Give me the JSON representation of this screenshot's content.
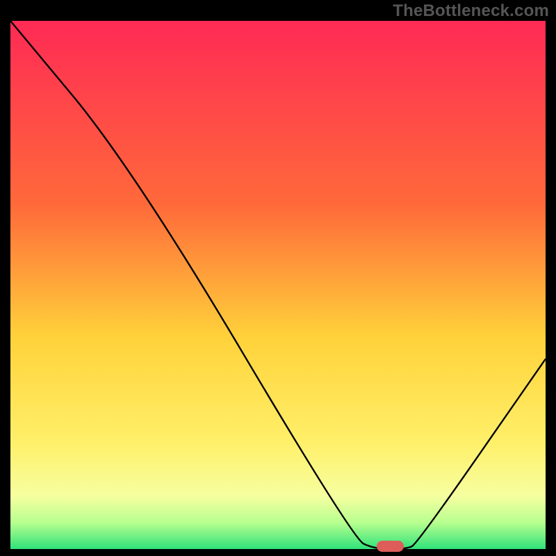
{
  "watermark": "TheBottleneck.com",
  "marker": {
    "label": "optimal-range",
    "x_center_pct": 71,
    "width_pct": 5
  },
  "chart_data": {
    "type": "line",
    "title": "",
    "xlabel": "",
    "ylabel": "",
    "xlim": [
      0,
      100
    ],
    "ylim": [
      0,
      100
    ],
    "gradient_stops": [
      {
        "offset": 0,
        "color": "#ff2a55"
      },
      {
        "offset": 35,
        "color": "#ff6a3a"
      },
      {
        "offset": 60,
        "color": "#ffd23a"
      },
      {
        "offset": 80,
        "color": "#fff06a"
      },
      {
        "offset": 90,
        "color": "#f6ffa0"
      },
      {
        "offset": 95,
        "color": "#b7ff8f"
      },
      {
        "offset": 100,
        "color": "#2fe27a"
      }
    ],
    "series": [
      {
        "name": "bottleneck-curve",
        "points": [
          {
            "x": 0,
            "y": 100
          },
          {
            "x": 23,
            "y": 72
          },
          {
            "x": 64,
            "y": 2
          },
          {
            "x": 68,
            "y": 0
          },
          {
            "x": 74,
            "y": 0
          },
          {
            "x": 76,
            "y": 1
          },
          {
            "x": 100,
            "y": 36
          }
        ]
      }
    ]
  }
}
